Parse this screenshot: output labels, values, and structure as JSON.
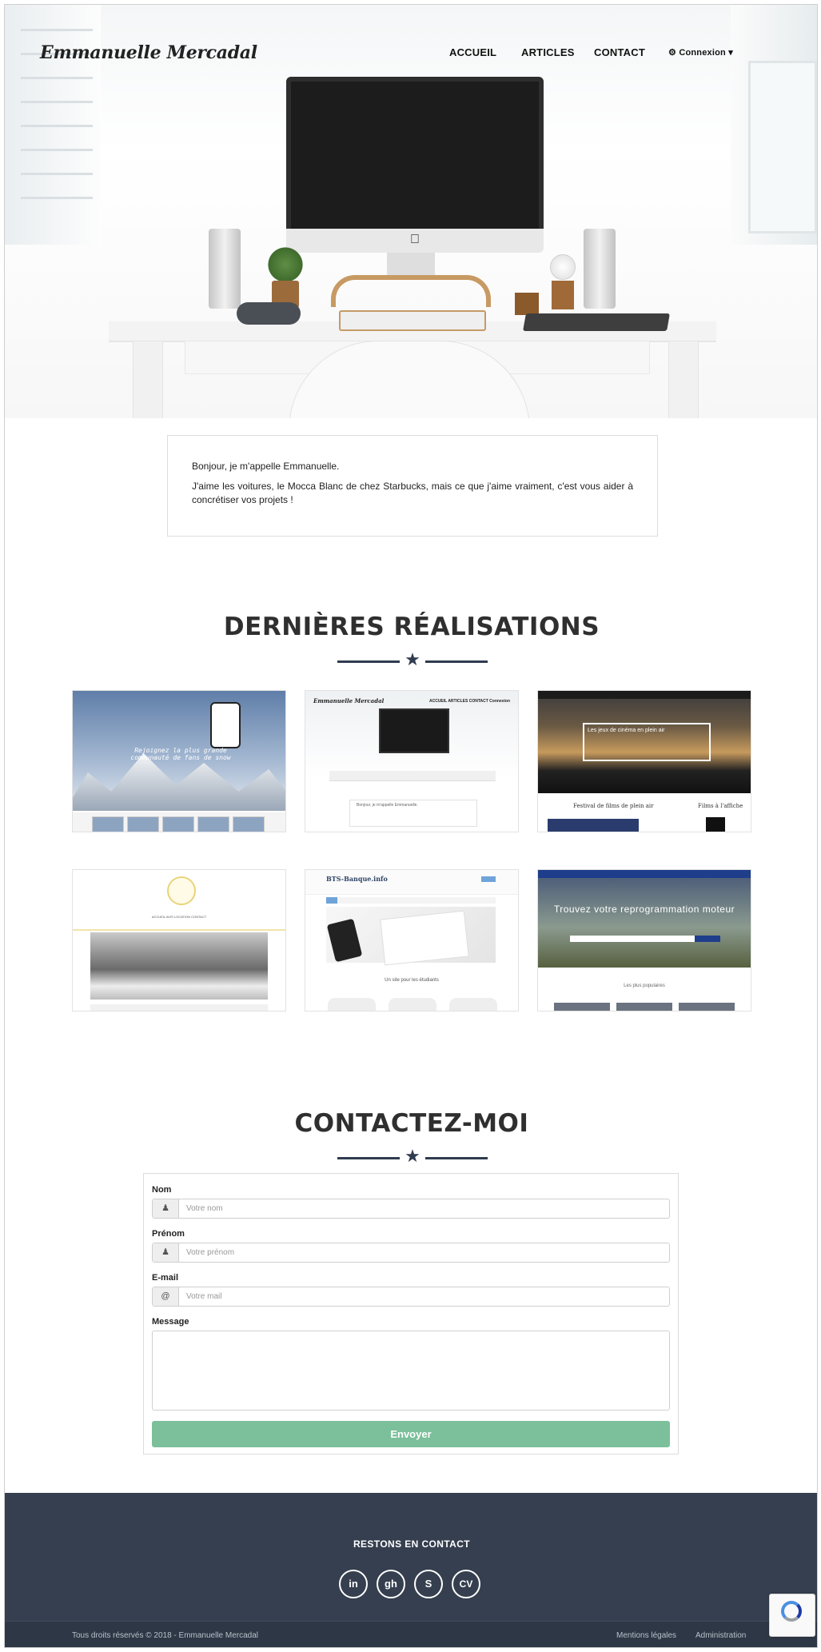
{
  "header": {
    "logo": "Emmanuelle Mercadal",
    "nav": [
      "ACCUEIL",
      "ARTICLES",
      "CONTACT"
    ],
    "login": "Connexion"
  },
  "intro": {
    "line1": "Bonjour, je m'appelle Emmanuelle.",
    "line2": "J'aime les voitures, le Mocca Blanc de chez Starbucks, mais ce que j'aime vraiment, c'est vous aider à concrétiser vos projets !"
  },
  "portfolio": {
    "title": "DERNIÈRES RÉALISATIONS",
    "items": [
      {
        "tagline": "Rejoignez la plus grande communauté de fans de snow"
      },
      {
        "logo": "Emmanuelle Mercadal",
        "nav": "ACCUEIL   ARTICLES   CONTACT   Connexion"
      },
      {
        "banner": "Les jeux de cinéma en plein air",
        "cap1": "Festival de films de plein air",
        "cap2": "Films à l'affiche"
      },
      {
        "menu": "ACCUEIL   AVIS   LOCATION   CONTACT"
      },
      {
        "title": "BTS-Banque.info",
        "subtitle": "Un site pour les étudiants"
      },
      {
        "headline": "Trouvez votre reprogrammation moteur",
        "popular": "Les plus populaires"
      }
    ]
  },
  "contact": {
    "title": "CONTACTEZ-MOI",
    "fields": [
      {
        "label": "Nom",
        "placeholder": "Votre nom",
        "icon": "user-icon"
      },
      {
        "label": "Prénom",
        "placeholder": "Votre prénom",
        "icon": "user-icon"
      },
      {
        "label": "E-mail",
        "placeholder": "Votre mail",
        "icon": "at-icon"
      }
    ],
    "message_label": "Message",
    "submit": "Envoyer"
  },
  "footer": {
    "title": "RESTONS EN CONTACT",
    "social": [
      "in",
      "gh",
      "S",
      "CV"
    ],
    "copyright": "Tous droits réservés © 2018 - Emmanuelle Mercadal",
    "links": [
      "Mentions légales",
      "Administration"
    ]
  },
  "colors": {
    "footer_bg": "#353f4f",
    "accent_navy": "#2f3b4f",
    "button_green": "#7cbf9b"
  }
}
